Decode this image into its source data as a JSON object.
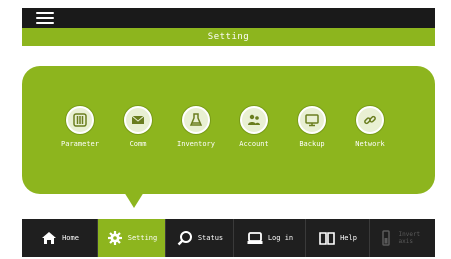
{
  "header": {
    "menu_icon": "hamburger-menu-icon",
    "title": "Setting"
  },
  "settings_panel": {
    "items": [
      {
        "label": "Parameter",
        "icon": "sliders-icon"
      },
      {
        "label": "Comm",
        "icon": "envelope-icon"
      },
      {
        "label": "Inventory",
        "icon": "flask-icon"
      },
      {
        "label": "Account",
        "icon": "users-icon"
      },
      {
        "label": "Backup",
        "icon": "monitor-icon"
      },
      {
        "label": "Network",
        "icon": "link-icon"
      }
    ]
  },
  "bottom_nav": {
    "items": [
      {
        "label": "Home",
        "icon": "home-icon",
        "state": "normal"
      },
      {
        "label": "Setting",
        "icon": "gear-icon",
        "state": "active"
      },
      {
        "label": "Status",
        "icon": "search-icon",
        "state": "normal"
      },
      {
        "label": "Log in",
        "icon": "printer-icon",
        "state": "normal"
      },
      {
        "label": "Help",
        "icon": "book-icon",
        "state": "normal"
      },
      {
        "label": "Invert axis",
        "icon": "battery-icon",
        "state": "disabled"
      }
    ]
  },
  "colors": {
    "accent": "#8db51e",
    "dark": "#1a1a1a",
    "text_light": "#ffffff",
    "disabled": "#5a5a5a"
  }
}
